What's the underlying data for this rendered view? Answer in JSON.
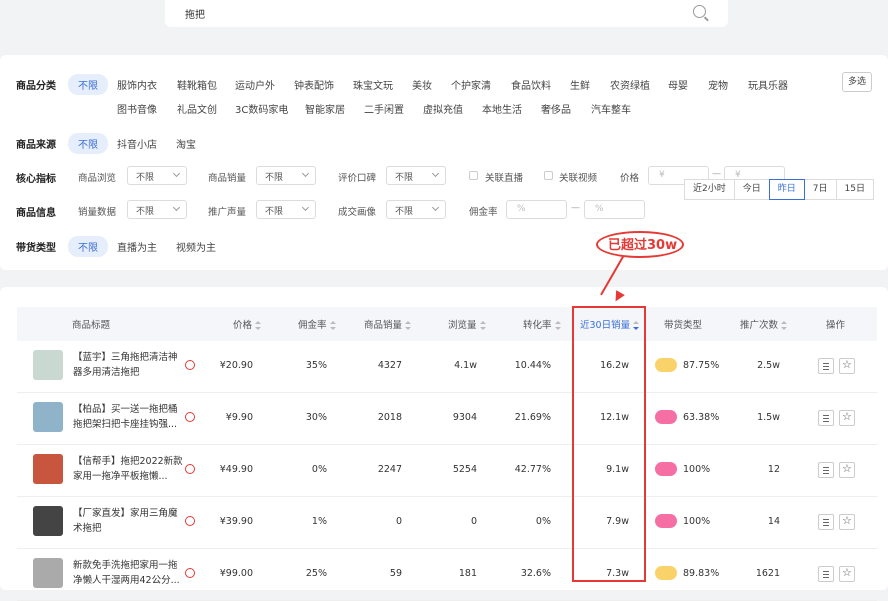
{
  "search": {
    "value": "拖把"
  },
  "filters": {
    "category": {
      "label": "商品分类",
      "options": [
        "不限",
        "服饰内衣",
        "鞋靴箱包",
        "运动户外",
        "钟表配饰",
        "珠宝文玩",
        "美妆",
        "个护家清",
        "食品饮料",
        "生鲜",
        "农资绿植",
        "母婴",
        "宠物",
        "玩具乐器",
        "图书音像",
        "礼品文创",
        "3C数码家电",
        "智能家居",
        "二手闲置",
        "虚拟充值",
        "本地生活",
        "奢侈品",
        "汽车整车"
      ],
      "multi": "多选"
    },
    "source": {
      "label": "商品来源",
      "options": [
        "不限",
        "抖音小店",
        "淘宝"
      ]
    },
    "core": {
      "label": "核心指标",
      "browse": "商品浏览",
      "sales": "商品销量",
      "rating": "评价口碑",
      "live": "关联直播",
      "video": "关联视频",
      "price": "价格",
      "unlimited": "不限",
      "yen": "¥"
    },
    "info": {
      "label": "商品信息",
      "sales_data": "销量数据",
      "promo": "推广声量",
      "deal_img": "成交画像",
      "commission": "佣金率",
      "unlimited": "不限",
      "pct": "%"
    },
    "type": {
      "label": "带货类型",
      "options": [
        "不限",
        "直播为主",
        "视频为主"
      ]
    },
    "time_tabs": [
      "近2小时",
      "今日",
      "昨日",
      "7日",
      "15日"
    ],
    "time_active": 2
  },
  "annotation": {
    "text": "已超过30w"
  },
  "table": {
    "headers": [
      "商品标题",
      "价格",
      "佣金率",
      "商品销量",
      "浏览量",
      "转化率",
      "近30日销量",
      "带货类型",
      "推广次数",
      "操作"
    ],
    "rows": [
      {
        "title": "【蓝宇】三角拖把清洁神器多用清洁拖把",
        "price": "¥20.90",
        "commission": "35%",
        "sales": "4327",
        "views": "4.1w",
        "conv": "10.44%",
        "sales30": "16.2w",
        "type_pct": "87.75%",
        "promo": "2.5w",
        "badge": "#f9d26a",
        "thumb": "#c9d8d0"
      },
      {
        "title": "【柏品】买一送一拖把桶拖把架扫把卡座挂钩强...",
        "price": "¥9.90",
        "commission": "30%",
        "sales": "2018",
        "views": "9304",
        "conv": "21.69%",
        "sales30": "12.1w",
        "type_pct": "63.38%",
        "promo": "1.5w",
        "badge": "#f56fa5",
        "thumb": "#8fb3c9"
      },
      {
        "title": "【信帮手】拖把2022新款家用一拖净平板拖懒...",
        "price": "¥49.90",
        "commission": "0%",
        "sales": "2247",
        "views": "5254",
        "conv": "42.77%",
        "sales30": "9.1w",
        "type_pct": "100%",
        "promo": "12",
        "badge": "#f56fa5",
        "thumb": "#c8553d"
      },
      {
        "title": "【厂家直发】家用三角魔术拖把",
        "price": "¥39.90",
        "commission": "1%",
        "sales": "0",
        "views": "0",
        "conv": "0%",
        "sales30": "7.9w",
        "type_pct": "100%",
        "promo": "14",
        "badge": "#f56fa5",
        "thumb": "#444"
      },
      {
        "title": "新款免手洗拖把家用一拖净懒人干湿两用42公分...",
        "price": "¥99.00",
        "commission": "25%",
        "sales": "59",
        "views": "181",
        "conv": "32.6%",
        "sales30": "7.3w",
        "type_pct": "89.83%",
        "promo": "1621",
        "badge": "#f9d26a",
        "thumb": "#aaa"
      }
    ]
  }
}
